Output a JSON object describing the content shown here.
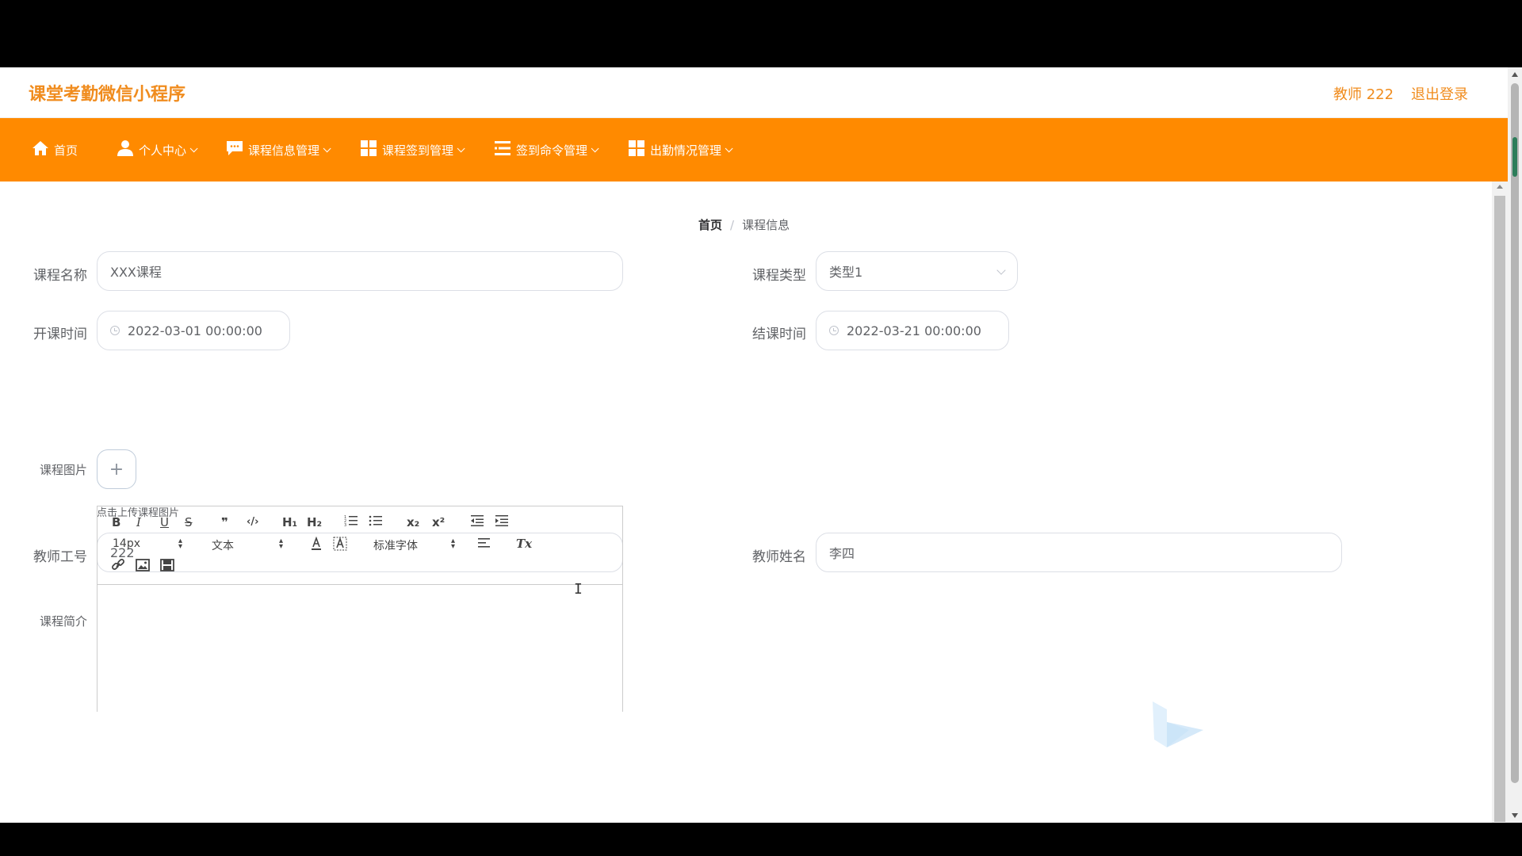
{
  "header": {
    "brand": "课堂考勤微信小程序",
    "user": "教师 222",
    "logout": "退出登录"
  },
  "nav": [
    {
      "label": "首页",
      "icon": "home-icon"
    },
    {
      "label": "个人中心",
      "icon": "user-icon"
    },
    {
      "label": "课程信息管理",
      "icon": "chat-icon"
    },
    {
      "label": "课程签到管理",
      "icon": "grid-icon"
    },
    {
      "label": "签到命令管理",
      "icon": "list-icon"
    },
    {
      "label": "出勤情况管理",
      "icon": "grid-icon"
    }
  ],
  "breadcrumb": {
    "home": "首页",
    "separator": "/",
    "current": "课程信息"
  },
  "form": {
    "course_name": {
      "label": "课程名称",
      "value": "XXX课程"
    },
    "course_type": {
      "label": "课程类型",
      "value": "类型1"
    },
    "start_time": {
      "label": "开课时间",
      "value": "2022-03-01 00:00:00"
    },
    "end_time": {
      "label": "结课时间",
      "value": "2022-03-21 00:00:00"
    },
    "course_image": {
      "label": "课程图片",
      "upload_symbol": "+",
      "tip": "点击上传课程图片"
    },
    "teacher_id": {
      "label": "教师工号",
      "value": "222"
    },
    "teacher_name": {
      "label": "教师姓名",
      "value": "李四"
    },
    "course_intro": {
      "label": "课程简介"
    }
  },
  "editor": {
    "bold": "B",
    "italic": "I",
    "underline": "U",
    "strike": "S",
    "quote": "❞",
    "code": "‹/›",
    "h1": "H₁",
    "h2": "H₂",
    "sub": "x₂",
    "sup": "x²",
    "size": "14px",
    "format": "文本",
    "font": "标准字体",
    "clean": "Tx"
  },
  "colors": {
    "accent": "#ff8a00",
    "brand_text": "#f08c1e"
  }
}
